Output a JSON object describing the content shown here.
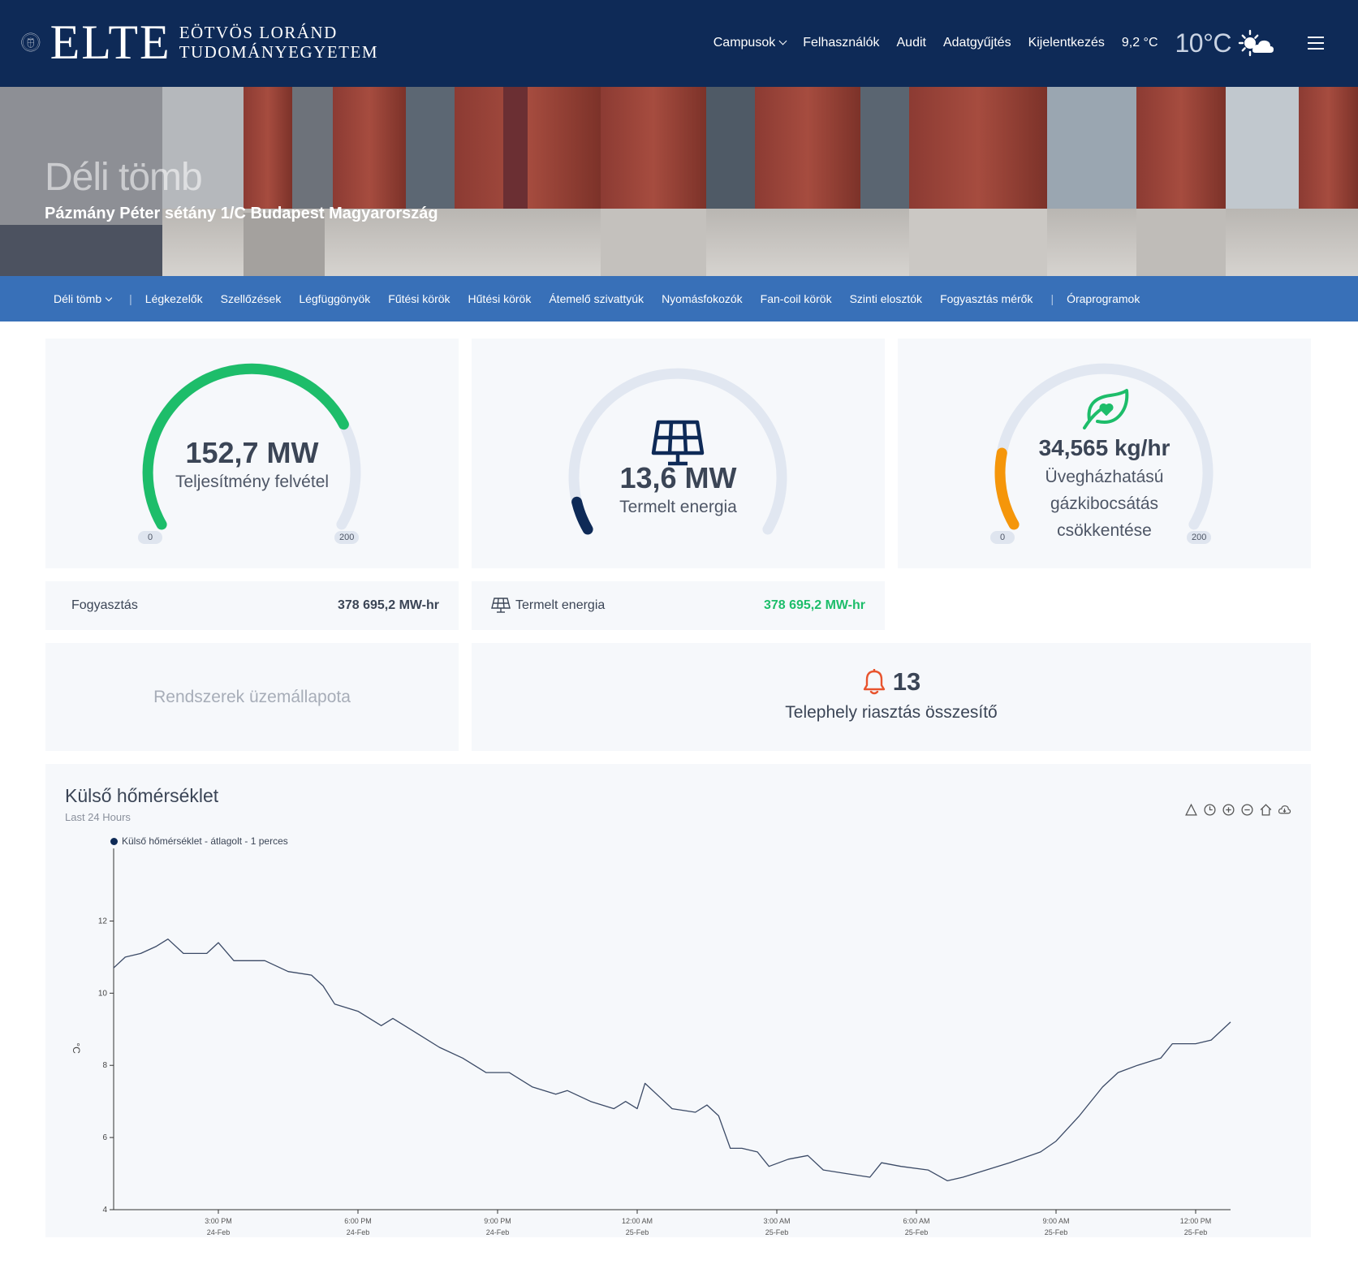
{
  "header": {
    "logo": {
      "wordmark": "ELTE",
      "line1": "EÖTVÖS LORÁND",
      "line2": "TUDOMÁNYEGYETEM"
    },
    "nav": [
      "Campusok",
      "Felhasználók",
      "Audit",
      "Adatgyűjtés",
      "Kijelentkezés"
    ],
    "indoor_temp": "9,2 °C",
    "outdoor_temp": "10°C",
    "weather_icon": "sun-cloud-icon",
    "menu_icon": "hamburger-icon"
  },
  "hero": {
    "title": "Déli tömb",
    "address": "Pázmány Péter sétány 1/C Budapest Magyarország"
  },
  "subnav": {
    "building": "Déli tömb",
    "items": [
      "Légkezelők",
      "Szellőzések",
      "Légfüggönyök",
      "Fűtési körök",
      "Hűtési körök",
      "Átemelő szivattyúk",
      "Nyomásfokozók",
      "Fan-coil körök",
      "Szinti elosztók",
      "Fogyasztás mérők"
    ],
    "extra": "Óraprogramok"
  },
  "gauges": [
    {
      "value": "152,7 MW",
      "label": "Teljesítmény felvétel",
      "min": "0",
      "max": "200",
      "fraction": 0.76,
      "color": "#1dbd6a"
    },
    {
      "value": "13,6 MW",
      "label": "Termelt energia",
      "fraction": 0.068,
      "color": "#0e2a57",
      "icon": "solar-panel-icon"
    },
    {
      "value": "34,565 kg/hr",
      "label_lines": [
        "Üvegházhatású",
        "gázkibocsátás",
        "csökkentése"
      ],
      "min": "0",
      "max": "200",
      "fraction": 0.17,
      "color": "#f5960a",
      "icon": "leaf-heart-icon"
    }
  ],
  "summary": {
    "consumption_label": "Fogyasztás",
    "consumption_value": "378 695,2 MW-hr",
    "produced_label": "Termelt energia",
    "produced_value": "378 695,2 MW-hr",
    "produced_color": "#1dbd6a"
  },
  "status": {
    "label": "Rendszerek üzemállapota"
  },
  "alarm": {
    "count": "13",
    "label": "Telephely riasztás összesítő",
    "icon": "bell-icon"
  },
  "chart": {
    "title": "Külső hőmérséklet",
    "subtitle": "Last 24 Hours",
    "legend": "Külső hőmérséklet - átlagolt - 1 perces",
    "toolbar": [
      "triangle-icon",
      "clock-icon",
      "zoom-in-icon",
      "zoom-out-icon",
      "home-icon",
      "download-icon"
    ]
  },
  "chart_data": {
    "type": "line",
    "ylabel": "°C",
    "ylim": [
      4,
      13
    ],
    "yticks": [
      "4",
      "6",
      "8",
      "10",
      "12"
    ],
    "xticks": [
      {
        "time": "3:00 PM",
        "date": "24-Feb"
      },
      {
        "time": "6:00 PM",
        "date": "24-Feb"
      },
      {
        "time": "9:00 PM",
        "date": "24-Feb"
      },
      {
        "time": "12:00 AM",
        "date": "25-Feb"
      },
      {
        "time": "3:00 AM",
        "date": "25-Feb"
      },
      {
        "time": "6:00 AM",
        "date": "25-Feb"
      },
      {
        "time": "9:00 AM",
        "date": "25-Feb"
      },
      {
        "time": "12:00 PM",
        "date": "25-Feb"
      }
    ],
    "xrange": [
      "24-Feb 12:45 PM",
      "25-Feb 12:45 PM"
    ],
    "series": [
      {
        "name": "Külső hőmérséklet - átlagolt - 1 perces",
        "color": "#3b4a66",
        "points": [
          [
            "24-Feb 12:45 PM",
            10.7
          ],
          [
            "24-Feb 1:00 PM",
            11.0
          ],
          [
            "24-Feb 1:20 PM",
            11.1
          ],
          [
            "24-Feb 1:40 PM",
            11.3
          ],
          [
            "24-Feb 1:55 PM",
            11.5
          ],
          [
            "24-Feb 2:15 PM",
            11.1
          ],
          [
            "24-Feb 2:45 PM",
            11.1
          ],
          [
            "24-Feb 3:00 PM",
            11.4
          ],
          [
            "24-Feb 3:20 PM",
            10.9
          ],
          [
            "24-Feb 4:00 PM",
            10.9
          ],
          [
            "24-Feb 4:30 PM",
            10.6
          ],
          [
            "24-Feb 5:00 PM",
            10.5
          ],
          [
            "24-Feb 5:15 PM",
            10.2
          ],
          [
            "24-Feb 5:30 PM",
            9.7
          ],
          [
            "24-Feb 6:00 PM",
            9.5
          ],
          [
            "24-Feb 6:30 PM",
            9.1
          ],
          [
            "24-Feb 6:45 PM",
            9.3
          ],
          [
            "24-Feb 7:15 PM",
            8.9
          ],
          [
            "24-Feb 7:45 PM",
            8.5
          ],
          [
            "24-Feb 8:15 PM",
            8.2
          ],
          [
            "24-Feb 8:45 PM",
            7.8
          ],
          [
            "24-Feb 9:15 PM",
            7.8
          ],
          [
            "24-Feb 9:45 PM",
            7.4
          ],
          [
            "24-Feb 10:15 PM",
            7.2
          ],
          [
            "24-Feb 10:30 PM",
            7.3
          ],
          [
            "24-Feb 11:00 PM",
            7.0
          ],
          [
            "24-Feb 11:30 PM",
            6.8
          ],
          [
            "24-Feb 11:45 PM",
            7.0
          ],
          [
            "25-Feb 12:00 AM",
            6.8
          ],
          [
            "25-Feb 12:10 AM",
            7.5
          ],
          [
            "25-Feb 12:30 AM",
            7.1
          ],
          [
            "25-Feb 12:45 AM",
            6.8
          ],
          [
            "25-Feb 1:15 AM",
            6.7
          ],
          [
            "25-Feb 1:30 AM",
            6.9
          ],
          [
            "25-Feb 1:45 AM",
            6.6
          ],
          [
            "25-Feb 2:00 AM",
            5.7
          ],
          [
            "25-Feb 2:15 AM",
            5.7
          ],
          [
            "25-Feb 2:35 AM",
            5.6
          ],
          [
            "25-Feb 2:50 AM",
            5.2
          ],
          [
            "25-Feb 3:15 AM",
            5.4
          ],
          [
            "25-Feb 3:40 AM",
            5.5
          ],
          [
            "25-Feb 4:00 AM",
            5.1
          ],
          [
            "25-Feb 4:30 AM",
            5.0
          ],
          [
            "25-Feb 5:00 AM",
            4.9
          ],
          [
            "25-Feb 5:15 AM",
            5.3
          ],
          [
            "25-Feb 5:40 AM",
            5.2
          ],
          [
            "25-Feb 6:15 AM",
            5.1
          ],
          [
            "25-Feb 6:40 AM",
            4.8
          ],
          [
            "25-Feb 7:00 AM",
            4.9
          ],
          [
            "25-Feb 7:30 AM",
            5.1
          ],
          [
            "25-Feb 8:00 AM",
            5.3
          ],
          [
            "25-Feb 8:40 AM",
            5.6
          ],
          [
            "25-Feb 9:00 AM",
            5.9
          ],
          [
            "25-Feb 9:30 AM",
            6.6
          ],
          [
            "25-Feb 10:00 AM",
            7.4
          ],
          [
            "25-Feb 10:20 AM",
            7.8
          ],
          [
            "25-Feb 10:45 AM",
            8.0
          ],
          [
            "25-Feb 11:15 AM",
            8.2
          ],
          [
            "25-Feb 11:30 AM",
            8.6
          ],
          [
            "25-Feb 12:00 PM",
            8.6
          ],
          [
            "25-Feb 12:20 PM",
            8.7
          ],
          [
            "25-Feb 12:45 PM",
            9.2
          ]
        ]
      }
    ]
  }
}
